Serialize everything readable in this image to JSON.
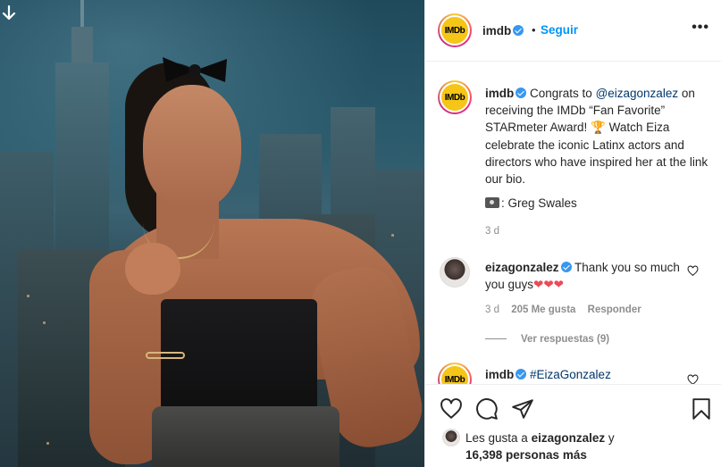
{
  "post": {
    "account": "imdb",
    "avatar_text": "IMDb",
    "separator": "•",
    "follow_label": "Seguir",
    "more_label": "•••"
  },
  "caption": {
    "username": "imdb",
    "text_before_mention": "Congrats to ",
    "mention": "@eizagonzalez",
    "text_after_mention": " on receiving the IMDb “Fan Favorite” STARmeter Award! 🏆 Watch Eiza celebrate the iconic Latinx actors and directors who have inspired her at the link our bio.",
    "credit": ": Greg Swales",
    "time": "3 d"
  },
  "comments": [
    {
      "username": "eizagonzalez",
      "text": "Thank you so much you guys",
      "hearts": "❤❤❤",
      "time": "3 d",
      "likes": "205 Me gusta",
      "reply_label": "Responder",
      "view_replies": "Ver respuestas (9)"
    },
    {
      "username": "imdb",
      "text": "#EizaGonzalez"
    }
  ],
  "likes": {
    "prefix": "Les gusta a ",
    "user": "eizagonzalez",
    "middle": " y",
    "count": "16,398 personas más"
  },
  "icons": {
    "download": "download-icon",
    "heart": "heart-icon",
    "comment": "comment-icon",
    "share": "share-icon",
    "save": "save-icon"
  },
  "colors": {
    "verified_blue": "#3897f0",
    "follow_blue": "#0095f6",
    "imdb_yellow": "#f5c518",
    "heart_red": "#ed4956"
  }
}
